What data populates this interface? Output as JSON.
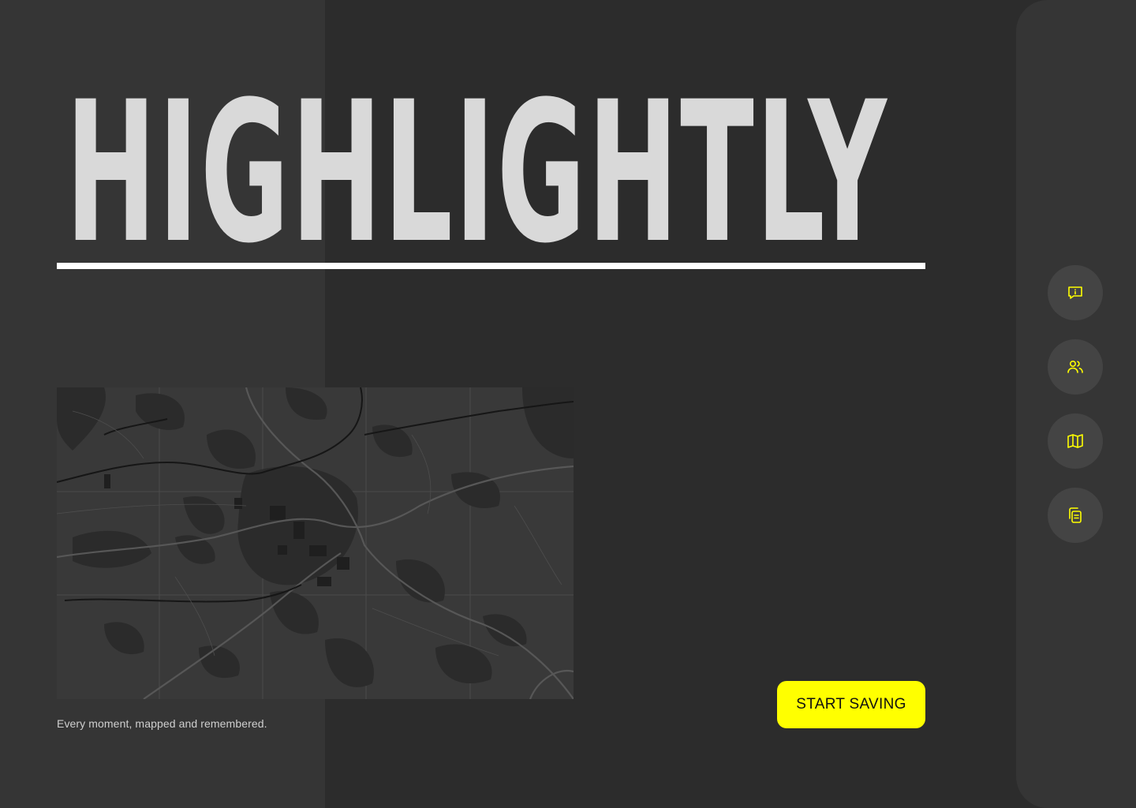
{
  "hero": {
    "title": "HIGHLIGHTLY"
  },
  "map": {
    "caption": "Every moment, mapped and remembered."
  },
  "cta": {
    "label": "START SAVING"
  },
  "rail": {
    "items": [
      {
        "icon": "feedback-icon"
      },
      {
        "icon": "users-icon"
      },
      {
        "icon": "map-icon"
      },
      {
        "icon": "copy-icon"
      }
    ]
  },
  "colors": {
    "background": "#2c2c2c",
    "band": "#353535",
    "accent": "#ffff00",
    "title": "#d9d9d9",
    "rail_button": "#444444"
  }
}
